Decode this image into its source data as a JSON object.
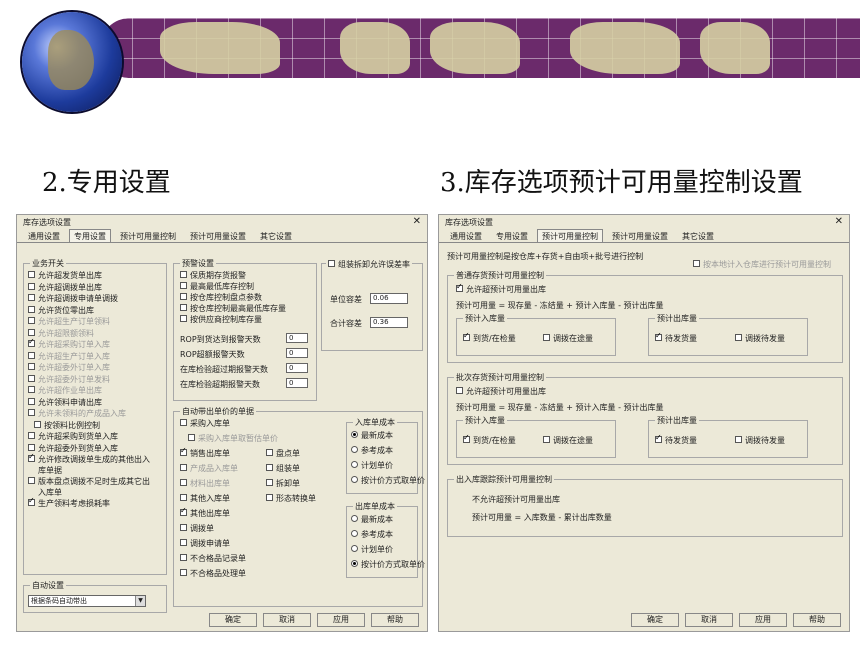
{
  "headings": {
    "left": "2.专用设置",
    "right": "3.库存选项预计可用量控制设置"
  },
  "colors": {
    "ribbon": "#6b2a6b",
    "dialog_bg": "#ece9d8"
  },
  "left_dialog": {
    "title": "库存选项设置",
    "tabs": [
      "通用设置",
      "专用设置",
      "预计可用量控制",
      "预计可用量设置",
      "其它设置"
    ],
    "active_tab": "专用设置",
    "business_switch": {
      "label": "业务开关",
      "items": [
        {
          "label": "允许超发货单出库",
          "checked": false,
          "dim": false
        },
        {
          "label": "允许超调拨单出库",
          "checked": false,
          "dim": false
        },
        {
          "label": "允许超调拨申请单调拨",
          "checked": false,
          "dim": false
        },
        {
          "label": "允许货位零出库",
          "checked": false,
          "dim": false
        },
        {
          "label": "允许超生产订单领料",
          "checked": false,
          "dim": true
        },
        {
          "label": "允许超限额领料",
          "checked": false,
          "dim": true
        },
        {
          "label": "允许超采购订单入库",
          "checked": true,
          "dim": true
        },
        {
          "label": "允许超生产订单入库",
          "checked": false,
          "dim": true
        },
        {
          "label": "允许超委外订单入库",
          "checked": false,
          "dim": true
        },
        {
          "label": "允许超委外订单发料",
          "checked": false,
          "dim": true
        },
        {
          "label": "允许超作业单出库",
          "checked": false,
          "dim": true
        },
        {
          "label": "允许领料申请出库",
          "checked": false,
          "dim": false
        },
        {
          "label": "允许未领料的产成品入库",
          "checked": false,
          "dim": true
        },
        {
          "label": "按领料比例控制",
          "checked": false,
          "dim": false
        },
        {
          "label": "允许超采购到货单入库",
          "checked": false,
          "dim": false
        },
        {
          "label": "允许超委外到货单入库",
          "checked": false,
          "dim": false
        },
        {
          "label": "允许修改调拨单生成的其他出入库单据",
          "checked": true,
          "dim": false
        },
        {
          "label": "版本盘点调拨不足时生成其它出入库单",
          "checked": false,
          "dim": false
        },
        {
          "label": "生产领料考虑损耗率",
          "checked": true,
          "dim": false
        }
      ]
    },
    "warning": {
      "label": "预警设置",
      "items": [
        {
          "label": "保质期存货报警",
          "checked": false
        },
        {
          "label": "最高最低库存控制",
          "checked": false
        },
        {
          "label": "按仓库控制盘点参数",
          "checked": false
        },
        {
          "label": "按仓库控制最高最低库存量",
          "checked": false
        },
        {
          "label": "按供应商控制库存量",
          "checked": false
        }
      ],
      "numbers": [
        {
          "label": "ROP到货达到报警天数",
          "value": "0"
        },
        {
          "label": "ROP超额报警天数",
          "value": "0"
        },
        {
          "label": "在库检验超过期报警天数",
          "value": "0"
        },
        {
          "label": "在库检验超期报警天数",
          "value": "0"
        }
      ]
    },
    "error_rate": {
      "label": "组装拆卸允许误差率",
      "checked": false,
      "unit_label": "单位容差",
      "unit_value": "0.06",
      "total_label": "合计容差",
      "total_value": "0.36"
    },
    "auto_fill": {
      "label": "自动带出单价的单据",
      "items": [
        {
          "label": "采购入库单",
          "checked": false,
          "dim": false
        },
        {
          "label": "采购入库单取暂估单价",
          "checked": false,
          "dim": true
        },
        {
          "label": "销售出库单",
          "checked": true,
          "dim": false
        },
        {
          "label": "产成品入库单",
          "checked": false,
          "dim": true
        },
        {
          "label": "材料出库单",
          "checked": false,
          "dim": true
        },
        {
          "label": "其他入库单",
          "checked": false,
          "dim": false
        },
        {
          "label": "其他出库单",
          "checked": true,
          "dim": false
        },
        {
          "label": "调拨单",
          "checked": false,
          "dim": false
        },
        {
          "label": "调拨申请单",
          "checked": false,
          "dim": false
        },
        {
          "label": "不合格品记录单",
          "checked": false,
          "dim": false
        },
        {
          "label": "不合格品处理单",
          "checked": false,
          "dim": false
        }
      ],
      "items2": [
        {
          "label": "盘点单",
          "checked": false
        },
        {
          "label": "组装单",
          "checked": false
        },
        {
          "label": "拆卸单",
          "checked": false
        },
        {
          "label": "形态转换单",
          "checked": false
        }
      ]
    },
    "in_cost": {
      "label": "入库单成本",
      "options": [
        "最新成本",
        "参考成本",
        "计划单价",
        "按计价方式取单价"
      ],
      "selected": 0
    },
    "out_cost": {
      "label": "出库单成本",
      "options": [
        "最新成本",
        "参考成本",
        "计划单价",
        "按计价方式取单价"
      ],
      "selected": 3
    },
    "auto_set": {
      "label": "自动设置",
      "value": "根据条码自动带出"
    },
    "buttons": [
      "确定",
      "取消",
      "应用",
      "帮助"
    ]
  },
  "right_dialog": {
    "title": "库存选项设置",
    "tabs": [
      "通用设置",
      "专用设置",
      "预计可用量控制",
      "预计可用量设置",
      "其它设置"
    ],
    "active_tab": "预计可用量控制",
    "top_text": "预计可用量控制是按仓库+存货+自由项+批号进行控制",
    "top_check": {
      "label": "按本地计入仓库进行预计可用量控制",
      "checked": false
    },
    "normal": {
      "label": "普通存货预计可用量控制",
      "allow": {
        "label": "允许超预计可用量出库",
        "checked": true
      },
      "formula": "预计可用量 = 现存量 - 冻结量 + 预计入库量 - 预计出库量",
      "in_group": {
        "label": "预计入库量",
        "items": [
          {
            "label": "到货/在检量",
            "checked": true
          },
          {
            "label": "调拨在途量",
            "checked": false
          }
        ]
      },
      "out_group": {
        "label": "预计出库量",
        "items": [
          {
            "label": "待发货量",
            "checked": true
          },
          {
            "label": "调拨待发量",
            "checked": false
          }
        ]
      }
    },
    "batch": {
      "label": "批次存货预计可用量控制",
      "allow": {
        "label": "允许超预计可用量出库",
        "checked": false
      },
      "formula": "预计可用量 = 现存量 - 冻结量 + 预计入库量 - 预计出库量",
      "in_group": {
        "label": "预计入库量",
        "items": [
          {
            "label": "到货/在检量",
            "checked": true
          },
          {
            "label": "调拨在途量",
            "checked": false
          }
        ]
      },
      "out_group": {
        "label": "预计出库量",
        "items": [
          {
            "label": "待发货量",
            "checked": true
          },
          {
            "label": "调拨待发量",
            "checked": false
          }
        ]
      }
    },
    "inout": {
      "label": "出入库跟踪预计可用量控制",
      "line1": "不允许超预计可用量出库",
      "line2": "预计可用量 = 入库数量 - 累计出库数量"
    },
    "buttons": [
      "确定",
      "取消",
      "应用",
      "帮助"
    ]
  }
}
